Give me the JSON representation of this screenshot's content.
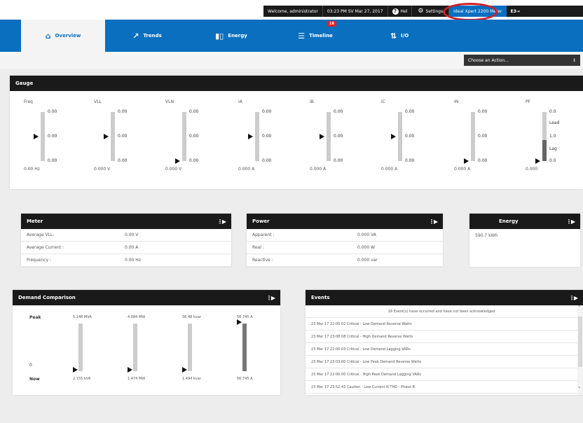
{
  "topbar": {
    "welcome": "Welcome, administrator",
    "datetime": "03:23 PM SV Mar 27, 2017",
    "help_label": "Hel",
    "settings_label": "Settings",
    "device_name": "Ideal Xpert 2200 Meter",
    "logout_label": "E3→"
  },
  "nav": {
    "tabs": [
      {
        "label": "Overview",
        "icon": "home-icon"
      },
      {
        "label": "Trends",
        "icon": "trend-icon"
      },
      {
        "label": "Energy",
        "icon": "bar-chart-icon"
      },
      {
        "label": "Timeline",
        "icon": "list-icon",
        "badge": "18"
      },
      {
        "label": "I/O",
        "icon": "io-arrows-icon"
      }
    ]
  },
  "action": {
    "label": "Choose an Action..."
  },
  "gauge_panel": {
    "title": "Gauge",
    "gauges": [
      {
        "label": "Freq",
        "top": "0.00",
        "mid": "0.00",
        "bottom": "0.00",
        "value": "0.00 Hz",
        "marker": 0.5
      },
      {
        "label": "VLL",
        "top": "0.00",
        "mid": "0.00",
        "bottom": "0.00",
        "value": "0.000 V",
        "marker": 0.5
      },
      {
        "label": "VLN",
        "top": "0.00",
        "mid": "0.00",
        "bottom": "0.00",
        "value": "0.000 V",
        "marker": 0.0
      },
      {
        "label": "IA",
        "top": "0.00",
        "mid": "0.00",
        "bottom": "0.00",
        "value": "0.000 A",
        "marker": 0.5
      },
      {
        "label": "IB",
        "top": "0.00",
        "mid": "0.00",
        "bottom": "0.00",
        "value": "0.000 A",
        "marker": 0.5
      },
      {
        "label": "IC",
        "top": "0.00",
        "mid": "0.00",
        "bottom": "0.00",
        "value": "0.000 A",
        "marker": 0.5
      },
      {
        "label": "IN",
        "top": "0.00",
        "mid": "0.00",
        "bottom": "0.00",
        "value": "0.000 A",
        "marker": 0.0
      },
      {
        "label": "PF",
        "top": "0.0",
        "mid": "1.0",
        "bottom": "0.0",
        "value": "0.000",
        "lead": "Lead",
        "lag": "Lag",
        "marker": 0.0
      }
    ]
  },
  "meter_panel": {
    "title": "Meter",
    "rows": [
      {
        "key": "Average VLL:",
        "value": "0.00 V"
      },
      {
        "key": "Average Current :",
        "value": "0.00 A"
      },
      {
        "key": "Frequency :",
        "value": "0.00 Hz"
      }
    ]
  },
  "power_panel": {
    "title": "Power",
    "rows": [
      {
        "key": "Apparent :",
        "value": "0.000 VA"
      },
      {
        "key": "Real :",
        "value": "0.000 W"
      },
      {
        "key": "Reactive :",
        "value": "0.000 var"
      }
    ]
  },
  "energy_panel": {
    "title": "Energy",
    "value": "590.7 kWh"
  },
  "demand_panel": {
    "title": "Demand Comparison",
    "peak_label": "Peak",
    "zero_label": "0",
    "now_label": "Now",
    "columns": [
      {
        "peak": "5.148 MVA",
        "now": "2.155 kVA",
        "fill": 0.0
      },
      {
        "peak": "4.684 MW",
        "now": "1.474 MW",
        "fill": 0.0
      },
      {
        "peak": "56.48 kvar",
        "now": "1.494 kvar",
        "fill": 0.0
      },
      {
        "peak": "56.745 A",
        "now": "56.745 A",
        "fill": 1.0
      }
    ]
  },
  "events_panel": {
    "title": "Events",
    "summary": "18 Event(s) have occurred and have not been acknowledged",
    "rows": [
      "23 Mar 17 22:00:02 Critical - Low Demand Reverse Watts",
      "23 Mar 17 23:08:08 Critical - High Demand Reverse Watts",
      "23 Mar 17 22:00:03 Critical - Low Demand Lagging VARs",
      "23 Mar 17 23:03:00 Critical - Low Peak Demand Reverse Watts",
      "23 Mar 17 22:00:00 Critical - High Peak Demand Lagging VARs",
      "23 Mar 17 23:52:43 Caution - Low Current N THD - Phase B"
    ]
  },
  "colors": {
    "primary": "#0a6fbf",
    "header": "#1a1a1a",
    "highlight_ring": "#d0202a",
    "badge": "#e62020"
  }
}
